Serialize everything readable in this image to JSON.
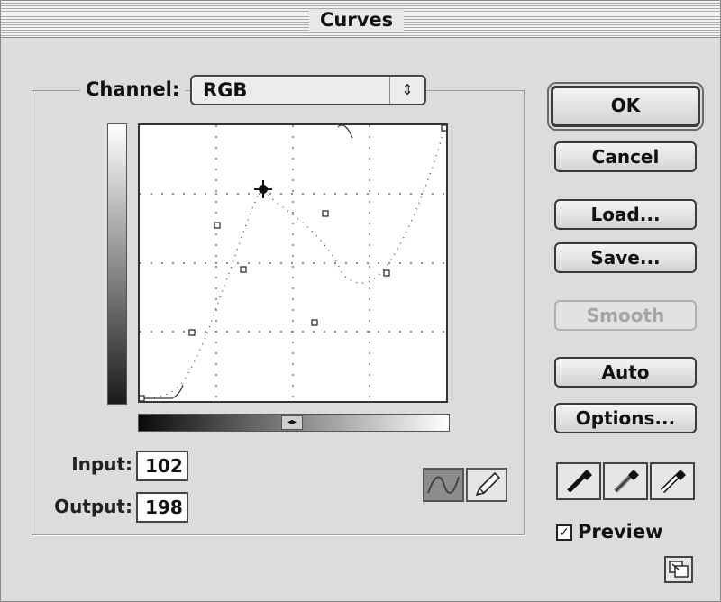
{
  "window": {
    "title": "Curves"
  },
  "channel": {
    "label": "Channel:",
    "value": "RGB"
  },
  "io": {
    "input_label": "Input:",
    "input_value": "102",
    "output_label": "Output:",
    "output_value": "198"
  },
  "buttons": {
    "ok": "OK",
    "cancel": "Cancel",
    "load": "Load...",
    "save": "Save...",
    "smooth": "Smooth",
    "auto": "Auto",
    "options": "Options..."
  },
  "preview": {
    "label": "Preview",
    "checked": true
  },
  "graph": {
    "input_range": [
      0,
      255
    ],
    "output_range": [
      0,
      255
    ],
    "grid_divisions": 4,
    "cursor_point": {
      "input": 102,
      "output": 198
    }
  },
  "icons": {
    "select_arrows": "up-down-arrows-icon",
    "curve_tool": "curve-tool-icon",
    "pencil_tool": "pencil-tool-icon",
    "black_eyedropper": "black-eyedropper-icon",
    "gray_eyedropper": "gray-eyedropper-icon",
    "white_eyedropper": "white-eyedropper-icon",
    "expand": "expand-dialog-icon",
    "gradient_toggle": "gradient-direction-toggle-icon"
  }
}
